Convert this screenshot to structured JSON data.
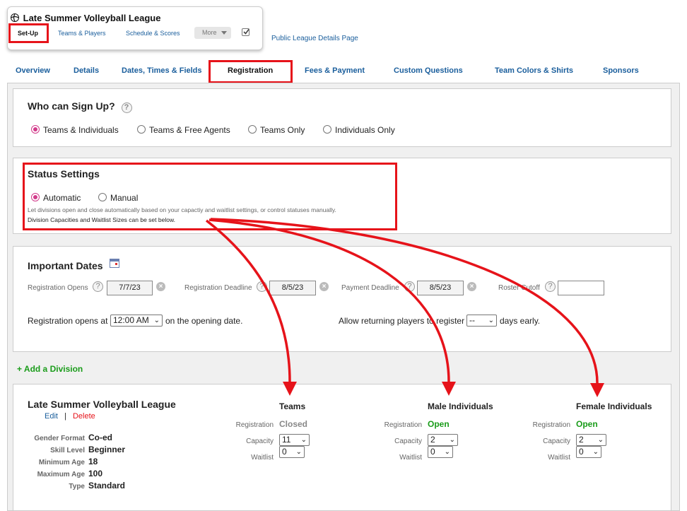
{
  "league": {
    "name": "Late Summer Volleyball League",
    "subnav": [
      "Set-Up",
      "Teams & Players",
      "Schedule & Scores",
      "More"
    ],
    "public_link": "Public League Details Page"
  },
  "tabs": [
    "Overview",
    "Details",
    "Dates, Times & Fields",
    "Registration",
    "Fees & Payment",
    "Custom Questions",
    "Team Colors & Shirts",
    "Sponsors"
  ],
  "signup": {
    "title": "Who can Sign Up?",
    "help": "?",
    "options": [
      "Teams & Individuals",
      "Teams & Free Agents",
      "Teams Only",
      "Individuals Only"
    ]
  },
  "status": {
    "title": "Status Settings",
    "options": [
      "Automatic",
      "Manual"
    ],
    "desc": "Let divisions open and close automatically based on your capactiy and waitlist settings, or control statuses manually.",
    "note": "Division Capacities and Waitlist Sizes can be set below."
  },
  "dates": {
    "title": "Important Dates",
    "reg_opens_label": "Registration Opens",
    "reg_opens": "7/7/23",
    "deadline_label": "Registration Deadline",
    "deadline": "8/5/23",
    "payment_label": "Payment Deadline",
    "payment": "8/5/23",
    "roster_label": "Roster Cutoff",
    "roster": "",
    "opens_at_pre": "Registration opens at",
    "opens_at": "12:00 AM",
    "opens_at_post": "on the opening date.",
    "returning_pre": "Allow returning players to register",
    "returning": "--",
    "returning_post": "days early."
  },
  "add_division": "+ Add a Division",
  "division": {
    "name": "Late Summer Volleyball League",
    "edit": "Edit",
    "sep": "|",
    "delete": "Delete",
    "details": [
      {
        "label": "Gender Format",
        "value": "Co-ed"
      },
      {
        "label": "Skill Level",
        "value": "Beginner"
      },
      {
        "label": "Minimum Age",
        "value": "18"
      },
      {
        "label": "Maximum Age",
        "value": "100"
      },
      {
        "label": "Type",
        "value": "Standard"
      }
    ],
    "row_labels": {
      "registration": "Registration",
      "capacity": "Capacity",
      "waitlist": "Waitlist"
    },
    "groups": [
      {
        "title": "Teams",
        "status": "Closed",
        "capacity": "11",
        "waitlist": "0"
      },
      {
        "title": "Male Individuals",
        "status": "Open",
        "capacity": "2",
        "waitlist": "0"
      },
      {
        "title": "Female Individuals",
        "status": "Open",
        "capacity": "2",
        "waitlist": "0"
      }
    ]
  },
  "colors": {
    "accent_red": "#e6131a",
    "open_green": "#1a9c1a",
    "closed_gray": "#888888",
    "radio_pink": "#d23a8a",
    "link_blue": "#1a5e9c"
  }
}
